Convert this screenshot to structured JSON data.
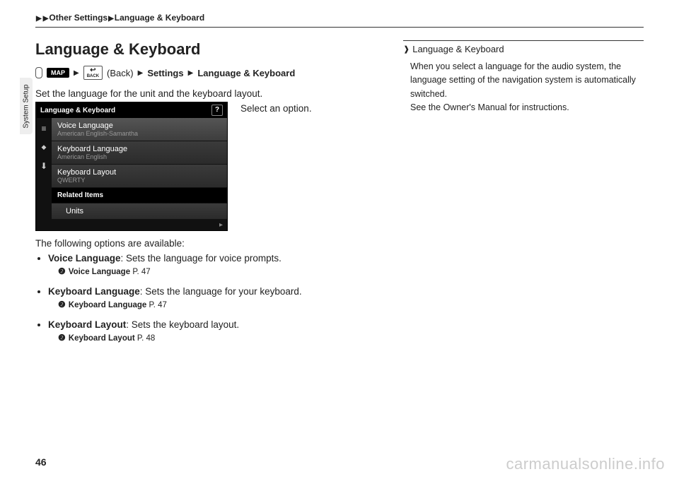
{
  "breadcrumb": {
    "a": "Other Settings",
    "b": "Language & Keyboard"
  },
  "sidetab": "System Setup",
  "title": "Language & Keyboard",
  "navpath": {
    "map": "MAP",
    "back": "BACK",
    "back_paren": "(Back)",
    "settings": "Settings",
    "lk": "Language & Keyboard"
  },
  "intro": "Set the language for the unit and the keyboard layout.",
  "instruction": "Select an option.",
  "screenshot": {
    "header": "Language & Keyboard",
    "help": "?",
    "items": [
      {
        "label": "Voice Language",
        "value": "American English-Samantha"
      },
      {
        "label": "Keyboard Language",
        "value": "American English"
      },
      {
        "label": "Keyboard Layout",
        "value": "QWERTY"
      }
    ],
    "related": "Related Items",
    "units": "Units"
  },
  "listhead": "The following options are available:",
  "options": [
    {
      "name": "Voice Language",
      "desc": ": Sets the language for voice prompts.",
      "ref": "Voice Language",
      "page": "P. 47"
    },
    {
      "name": "Keyboard Language",
      "desc": ": Sets the language for your keyboard.",
      "ref": "Keyboard Language",
      "page": "P. 47"
    },
    {
      "name": "Keyboard Layout",
      "desc": ": Sets the keyboard layout.",
      "ref": "Keyboard Layout",
      "page": "P. 48"
    }
  ],
  "sidebox": {
    "title": "Language & Keyboard",
    "p1": "When you select a language for the audio system, the language setting of the navigation system is automatically switched.",
    "p2": "See the Owner's Manual for instructions."
  },
  "page_number": "46",
  "watermark": "carmanualsonline.info"
}
